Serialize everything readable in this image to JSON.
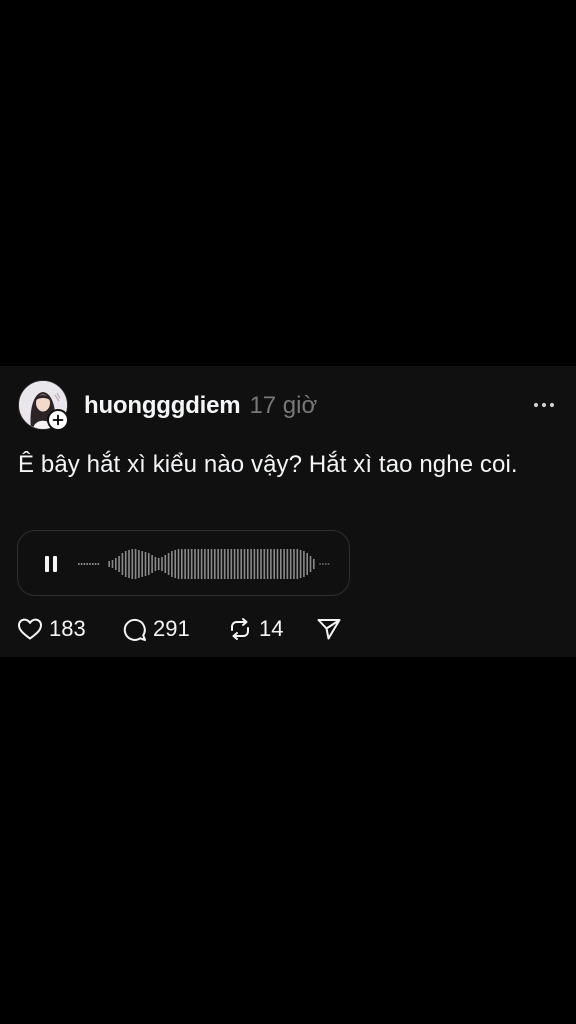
{
  "post": {
    "username": "huongggdiem",
    "time": "17 giờ",
    "text": "Ê bây hắt xì kiểu nào vậy? Hắt xì tao nghe coi.",
    "audio": {
      "state": "playing",
      "icon": "pause-icon"
    },
    "actions": {
      "likes": "183",
      "replies": "291",
      "reposts": "14"
    },
    "icons": {
      "more": "more-horizontal-icon",
      "like": "heart-icon",
      "reply": "comment-bubble-icon",
      "repost": "repost-icon",
      "share": "send-icon",
      "follow": "plus-icon"
    }
  },
  "colors": {
    "background": "#000000",
    "card": "#101010",
    "text_primary": "#f3f5f7",
    "text_secondary": "#777777",
    "border": "#2e2e2e"
  }
}
